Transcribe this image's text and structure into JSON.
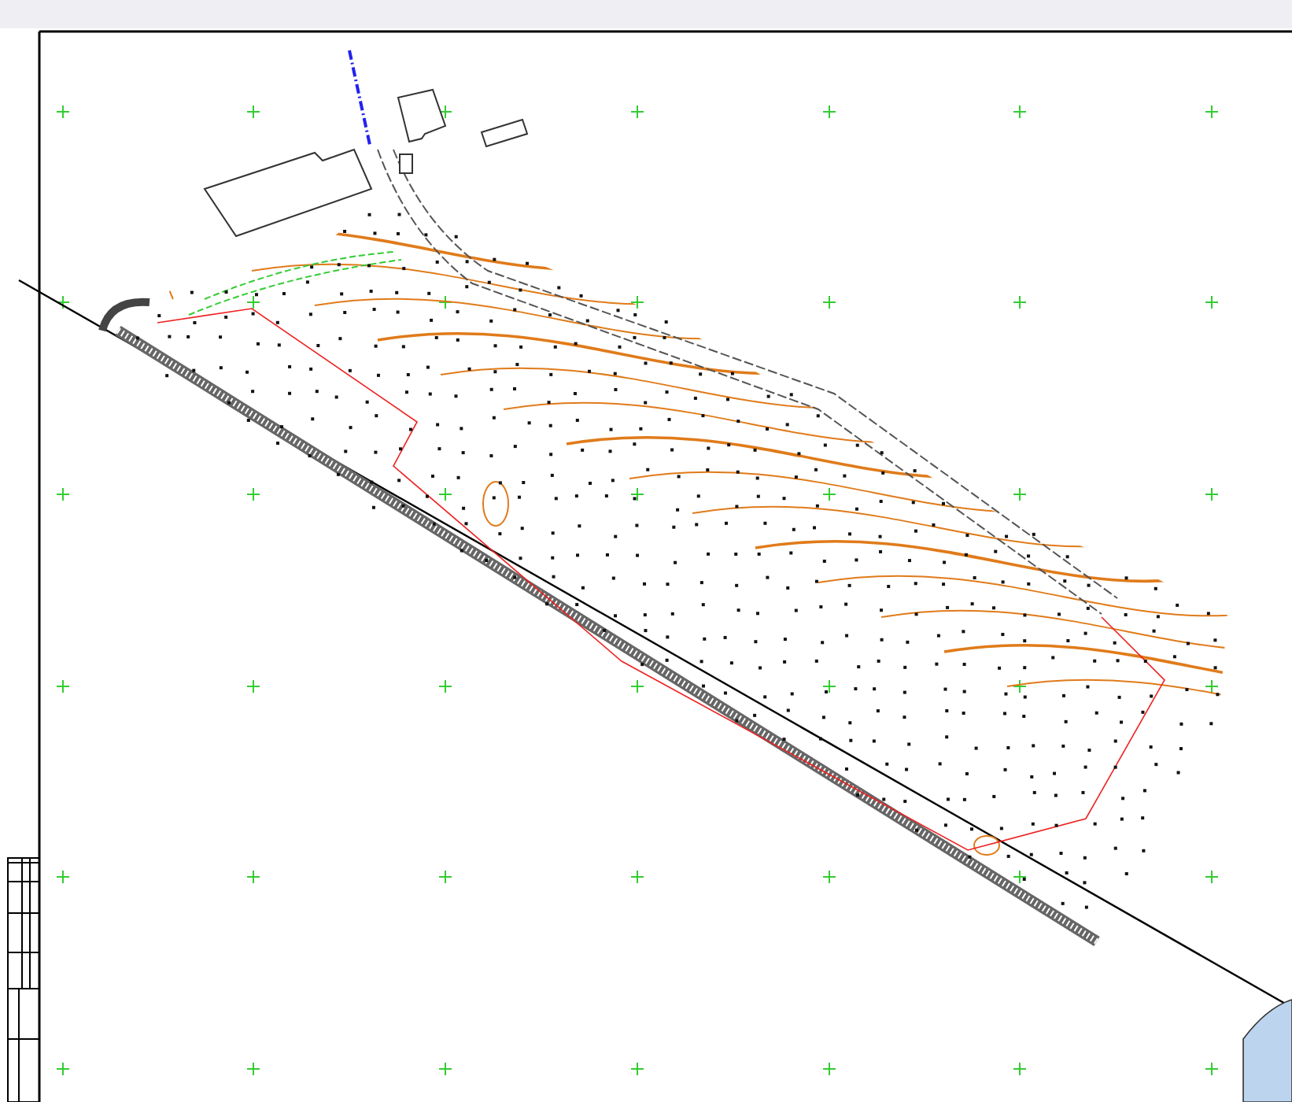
{
  "document": {
    "kind": "survey-plan"
  }
}
